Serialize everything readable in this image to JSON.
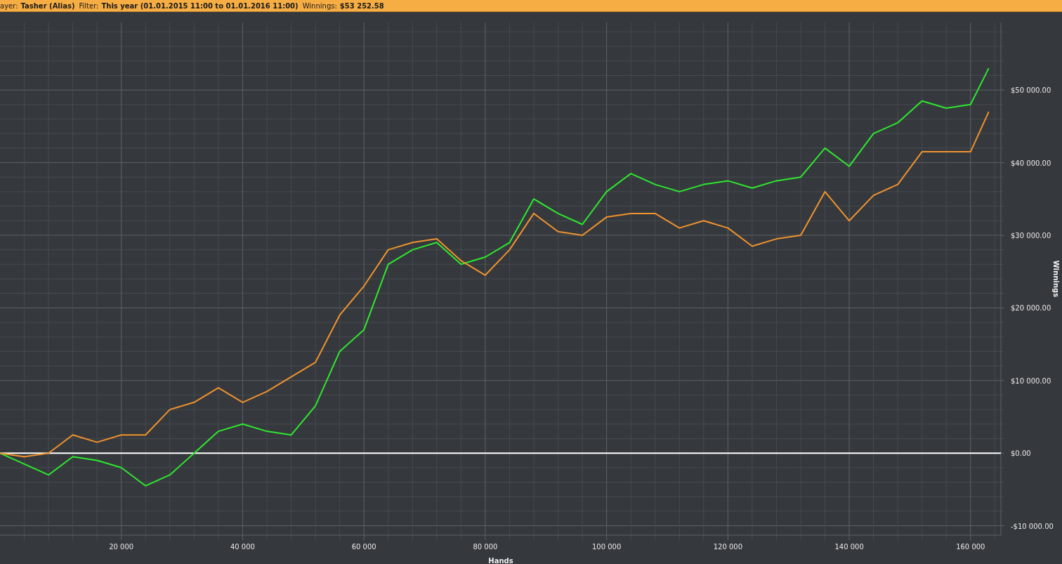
{
  "info_bar": {
    "fields": [
      {
        "label": "ayer:",
        "value": "Tasher (Alias)"
      },
      {
        "label": "Filter:",
        "value": "This year (01.01.2015 11:00 to 01.01.2016 11:00)"
      },
      {
        "label": "Winnings:",
        "value": "$53 252.58"
      }
    ]
  },
  "chart": {
    "chart_data": {
      "type": "line",
      "grid": true,
      "xlabel": "Hands",
      "ylabel": "Winnings",
      "x": [
        0,
        4000,
        8000,
        12000,
        16000,
        20000,
        24000,
        28000,
        32000,
        36000,
        40000,
        44000,
        48000,
        52000,
        56000,
        60000,
        64000,
        68000,
        72000,
        76000,
        80000,
        84000,
        88000,
        92000,
        96000,
        100000,
        104000,
        108000,
        112000,
        116000,
        120000,
        124000,
        128000,
        132000,
        136000,
        140000,
        144000,
        148000,
        152000,
        156000,
        160000,
        163000
      ],
      "series": [
        {
          "color": "#2ee82e",
          "values": [
            0,
            -1500,
            -3000,
            -500,
            -1000,
            -2000,
            -4500,
            -3000,
            0,
            3000,
            4000,
            3000,
            2500,
            6500,
            14000,
            17000,
            26000,
            28000,
            29000,
            26000,
            27000,
            29000,
            35000,
            33000,
            31500,
            36000,
            38500,
            37000,
            36000,
            37000,
            37500,
            36500,
            37500,
            38000,
            42000,
            39500,
            44000,
            45500,
            48500,
            47500,
            48000,
            53000
          ]
        },
        {
          "color": "#f0922e",
          "values": [
            0,
            -500,
            0,
            2500,
            1500,
            2500,
            2500,
            6000,
            7000,
            9000,
            7000,
            8500,
            10500,
            12500,
            19000,
            23000,
            28000,
            29000,
            29500,
            26500,
            24500,
            28000,
            33000,
            30500,
            30000,
            32500,
            33000,
            33000,
            31000,
            32000,
            31000,
            28500,
            29500,
            30000,
            36000,
            32000,
            35500,
            37000,
            41500,
            41500,
            41500,
            47000
          ]
        }
      ],
      "xlim": [
        0,
        165000
      ],
      "ylim": [
        -11300,
        59300
      ],
      "xticks": [
        {
          "value": 20000,
          "label": "20 000"
        },
        {
          "value": 40000,
          "label": "40 000"
        },
        {
          "value": 60000,
          "label": "60 000"
        },
        {
          "value": 80000,
          "label": "80 000"
        },
        {
          "value": 100000,
          "label": "100 000"
        },
        {
          "value": 120000,
          "label": "120 000"
        },
        {
          "value": 140000,
          "label": "140 000"
        },
        {
          "value": 160000,
          "label": "160 000"
        }
      ],
      "yticks": [
        {
          "value": -10000,
          "label": "-$10 000.00"
        },
        {
          "value": 0,
          "label": "$0.00"
        },
        {
          "value": 10000,
          "label": "$10 000.00"
        },
        {
          "value": 20000,
          "label": "$20 000.00"
        },
        {
          "value": 30000,
          "label": "$30 000.00"
        },
        {
          "value": 40000,
          "label": "$40 000.00"
        },
        {
          "value": 50000,
          "label": "$50 000.00"
        }
      ]
    }
  }
}
